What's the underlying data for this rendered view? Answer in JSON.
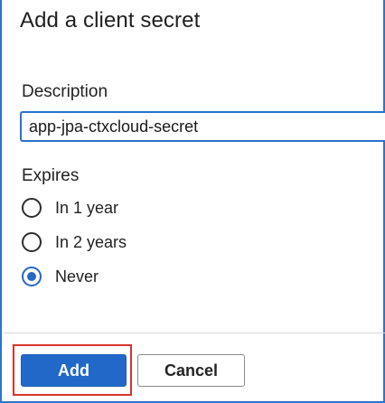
{
  "panel": {
    "title": "Add a client secret"
  },
  "description": {
    "label": "Description",
    "value": "app-jpa-ctxcloud-secret"
  },
  "expires": {
    "label": "Expires",
    "options": [
      {
        "label": "In 1 year",
        "selected": false
      },
      {
        "label": "In 2 years",
        "selected": false
      },
      {
        "label": "Never",
        "selected": true
      }
    ]
  },
  "footer": {
    "add_label": "Add",
    "cancel_label": "Cancel"
  },
  "colors": {
    "accent": "#2168c9",
    "highlight": "#d9342b"
  }
}
